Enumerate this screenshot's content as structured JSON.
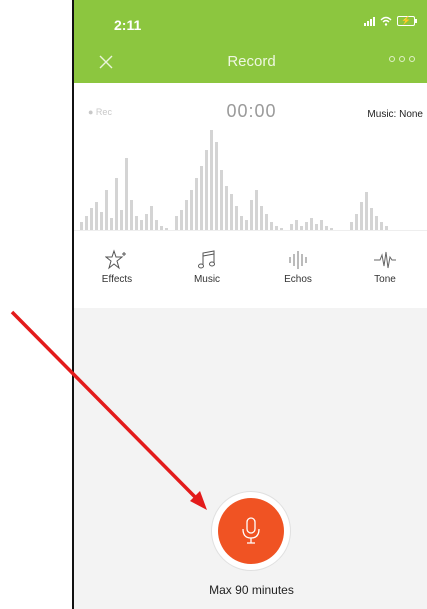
{
  "status_bar": {
    "time": "2:11"
  },
  "nav": {
    "title": "Record"
  },
  "recorder": {
    "rec_label": "● Rec",
    "timer": "00:00",
    "music_status": "Music: None"
  },
  "tools": [
    {
      "label": "Effects",
      "icon": "star-sparkle-icon"
    },
    {
      "label": "Music",
      "icon": "music-note-icon"
    },
    {
      "label": "Echos",
      "icon": "echo-bars-icon"
    },
    {
      "label": "Tone",
      "icon": "tone-wave-icon"
    }
  ],
  "record": {
    "max_label": "Max 90 minutes"
  },
  "colors": {
    "brand_green": "#8cc63f",
    "record_red": "#f05323",
    "annotation_arrow": "#e31b1b"
  }
}
